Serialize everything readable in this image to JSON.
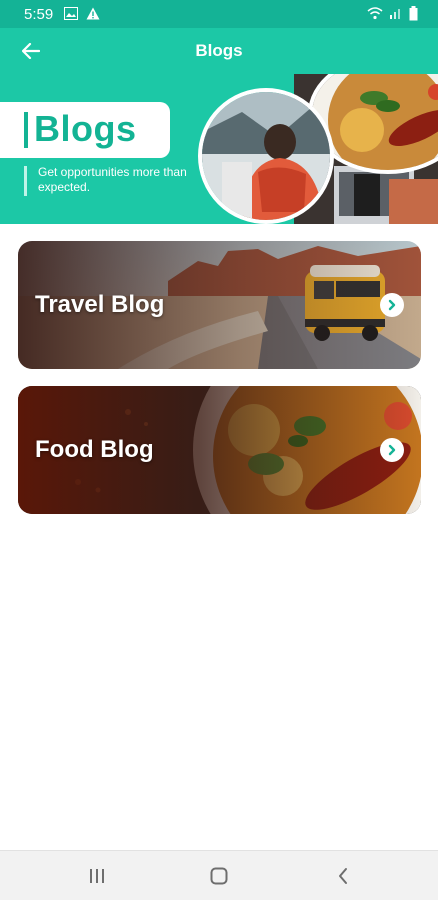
{
  "status_bar": {
    "time": "5:59",
    "icons": [
      "image-icon",
      "warning-icon",
      "wifi-icon",
      "signal-icon",
      "battery-icon"
    ]
  },
  "app_bar": {
    "title": "Blogs",
    "back_icon": "arrow-left-icon"
  },
  "hero": {
    "label": "Blogs",
    "subtitle": "Get opportunities more than expected."
  },
  "cards": [
    {
      "title": "Travel Blog",
      "icon": "chevron-right-icon"
    },
    {
      "title": "Food Blog",
      "icon": "chevron-right-icon"
    }
  ],
  "nav_bar": {
    "buttons": [
      "recent-apps-icon",
      "home-icon",
      "back-icon"
    ]
  },
  "colors": {
    "primary": "#1cc8a6",
    "primary_dark": "#14b396",
    "accent_text": "#13b394"
  }
}
